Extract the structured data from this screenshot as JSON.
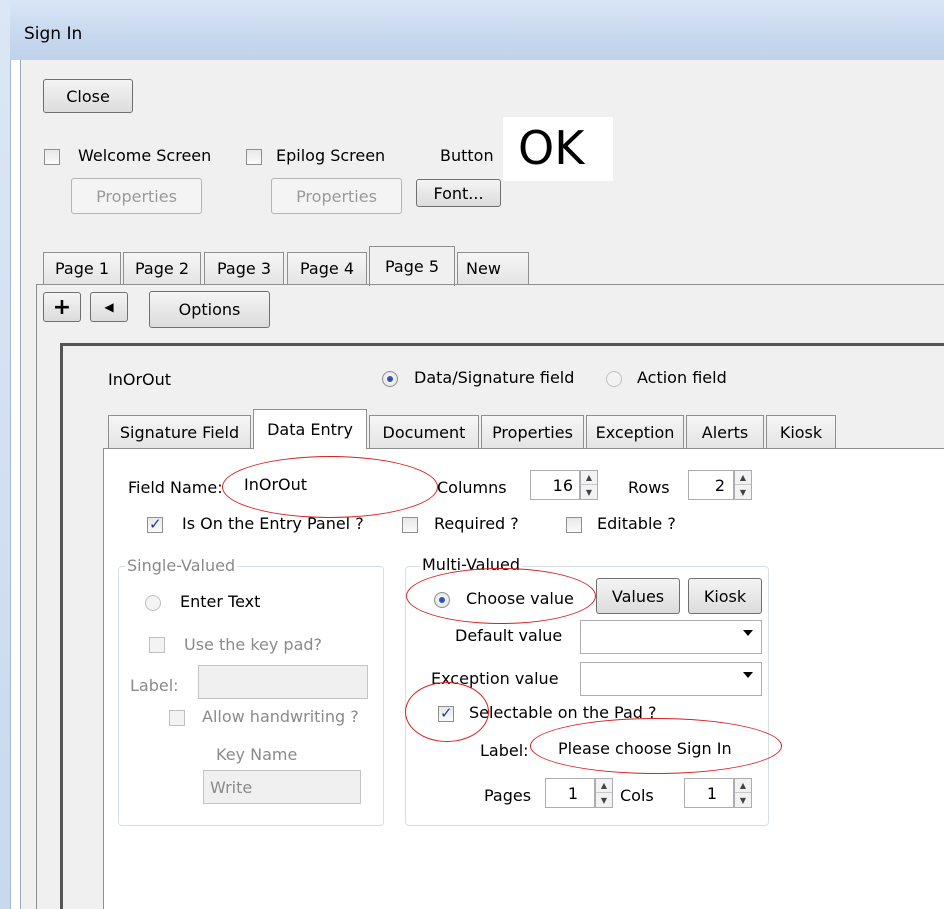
{
  "window": {
    "title": "Sign In"
  },
  "toolbar": {
    "close_label": "Close",
    "welcome_screen_label": "Welcome Screen",
    "epilog_screen_label": "Epilog Screen",
    "button_label": "Button",
    "ok_preview": "OK",
    "properties_label": "Properties",
    "font_label": "Font..."
  },
  "page_tabs": [
    "Page 1",
    "Page 2",
    "Page 3",
    "Page 4",
    "Page 5",
    "New"
  ],
  "page_toolbar": {
    "options_label": "Options",
    "add_icon": "plus-icon",
    "prev_icon": "left-arrow-icon"
  },
  "field": {
    "name": "InOrOut",
    "type_data_signature": "Data/Signature field",
    "type_action": "Action field"
  },
  "field_tabs": [
    "Signature Field",
    "Data Entry",
    "Document",
    "Properties",
    "Exception",
    "Alerts",
    "Kiosk"
  ],
  "data_entry": {
    "field_name_label": "Field Name:",
    "field_name_value": "InOrOut",
    "columns_label": "Columns",
    "columns_value": "16",
    "rows_label": "Rows",
    "rows_value": "2",
    "on_entry_panel_label": "Is On the Entry Panel ?",
    "required_label": "Required ?",
    "editable_label": "Editable ?"
  },
  "single_valued": {
    "title": "Single-Valued",
    "enter_text_label": "Enter Text",
    "use_keypad_label": "Use the key pad?",
    "label_label": "Label:",
    "allow_handwriting_label": "Allow handwriting ?",
    "key_name_label": "Key Name",
    "key_name_value": "Write"
  },
  "multi_valued": {
    "title": "Multi-Valued",
    "choose_value_label": "Choose value",
    "values_button": "Values",
    "kiosk_button": "Kiosk",
    "default_value_label": "Default value",
    "exception_value_label": "Exception value",
    "selectable_label": "Selectable on the Pad ?",
    "label_label": "Label:",
    "label_value": "Please choose Sign In",
    "pages_label": "Pages",
    "pages_value": "1",
    "cols_label": "Cols",
    "cols_value": "1"
  },
  "colors": {
    "annotation": "#d42020",
    "title_gradient": "#c7d8ee"
  }
}
